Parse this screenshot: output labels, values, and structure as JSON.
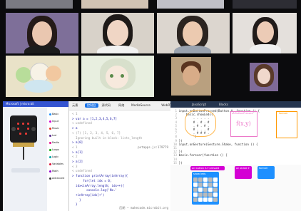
{
  "participants": [
    {
      "name": "",
      "hair": "#2a1e16",
      "bg": "#7a7a82"
    },
    {
      "name": "",
      "hair": "#1a1512",
      "bg": "#d1c3b3"
    },
    {
      "name": "",
      "hair": "#2e241e",
      "bg": "#bfbfc7"
    },
    {
      "name": "",
      "hair": "#1e1a18",
      "bg": "#ddd9d4"
    },
    {
      "name": "",
      "hair": "#5a3a2a",
      "bg": "#7f6a98"
    },
    {
      "name": "",
      "hair": "#7a4a2a",
      "bg": "#b9a07f"
    },
    {
      "name": "",
      "hair": "#201b1a",
      "bg": "#d8d2c9"
    }
  ],
  "makecode": {
    "title": "Microsoft | micro:bit",
    "categories": [
      {
        "label": "Basic",
        "color": "#1e90ff"
      },
      {
        "label": "Input",
        "color": "#d400d4"
      },
      {
        "label": "Music",
        "color": "#e63022"
      },
      {
        "label": "Led",
        "color": "#5c2d91"
      },
      {
        "label": "Radio",
        "color": "#e3008c"
      },
      {
        "label": "Loops",
        "color": "#00aa00"
      },
      {
        "label": "Logic",
        "color": "#00a4a6"
      },
      {
        "label": "Variables",
        "color": "#dc143c"
      },
      {
        "label": "Math",
        "color": "#9400d3"
      },
      {
        "label": "Advanced",
        "color": "#3c3c3c"
      }
    ]
  },
  "devtools": {
    "tabs": [
      "元素",
      "控制台",
      "源代码",
      "网络",
      "MediaSource",
      "WebRTC"
    ],
    "active_tab": "控制台",
    "lines": [
      {
        "t": "< 1",
        "cls": "res"
      },
      {
        "t": "> var a = [1,2,3,4,5,6,7]",
        "cls": "code"
      },
      {
        "t": "< undefined",
        "cls": "res"
      },
      {
        "t": "> a",
        "cls": "code"
      },
      {
        "t": "< (7) [1, 2, 3, 4, 5, 6, 7]",
        "cls": "res"
      },
      {
        "t": "  Ignoring built in block: lists_length",
        "cls": "res"
      },
      {
        "t": "> a[0]",
        "cls": "code"
      },
      {
        "t": "< 1",
        "cls": "res"
      },
      {
        "t": "> a[1]",
        "cls": "code"
      },
      {
        "t": "< 2",
        "cls": "res"
      },
      {
        "t": "> a[2]",
        "cls": "code"
      },
      {
        "t": "< 3",
        "cls": "res"
      },
      {
        "t": "< undefined",
        "cls": "res"
      },
      {
        "t": "> function printArray(inArray){",
        "cls": "code"
      },
      {
        "t": "      for(let idx = 0;",
        "cls": "code"
      },
      {
        "t": "  idx<inArray.length; idx++){",
        "cls": "code"
      },
      {
        "t": "        console.log('No.'",
        "cls": "code"
      },
      {
        "t": "  +inArray[idx]+')",
        "cls": "code"
      },
      {
        "t": "    }",
        "cls": "code"
      },
      {
        "t": "  }",
        "cls": "code"
      }
    ],
    "source_ref": "pxtapps.js:179779",
    "footer_ref": "后期 — makecode.microbit.org"
  },
  "editor": {
    "tabs": [
      "JavaScript",
      "Blocks"
    ],
    "lines": [
      {
        "n": "1",
        "t": "input.onButtonPressed(Button.A, function () {"
      },
      {
        "n": "2",
        "t": "    basic.showLeds(`"
      },
      {
        "n": "3",
        "t": "        . . . . ."
      },
      {
        "n": "4",
        "t": "        # . # . #"
      },
      {
        "n": "5",
        "t": "        . # . # ."
      },
      {
        "n": "6",
        "t": "        # . . . #"
      },
      {
        "n": "7",
        "t": "        . # # # ."
      },
      {
        "n": "8",
        "t": "        `)"
      },
      {
        "n": "9",
        "t": "})"
      },
      {
        "n": "10",
        "t": "input.onGesture(Gesture.Shake, function () {"
      },
      {
        "n": "11",
        "t": ""
      },
      {
        "n": "12",
        "t": "})"
      },
      {
        "n": "13",
        "t": "basic.forever(function () {"
      },
      {
        "n": "14",
        "t": ""
      },
      {
        "n": "15",
        "t": "})"
      }
    ],
    "annotations": {
      "label1": "onButtonPressed",
      "label2": "forever",
      "formula": "f(x,y)"
    },
    "blocks": {
      "button_block": "on button A ▾ pressed",
      "shake_block": "on shake ▾",
      "forever_block": "forever",
      "show_leds": "show leds"
    },
    "led_pattern": [
      0,
      0,
      1,
      0,
      1,
      1,
      0,
      1,
      0,
      1,
      0,
      1,
      0,
      1,
      0,
      1,
      0,
      0,
      0,
      1,
      0,
      1,
      1,
      1,
      0
    ]
  }
}
